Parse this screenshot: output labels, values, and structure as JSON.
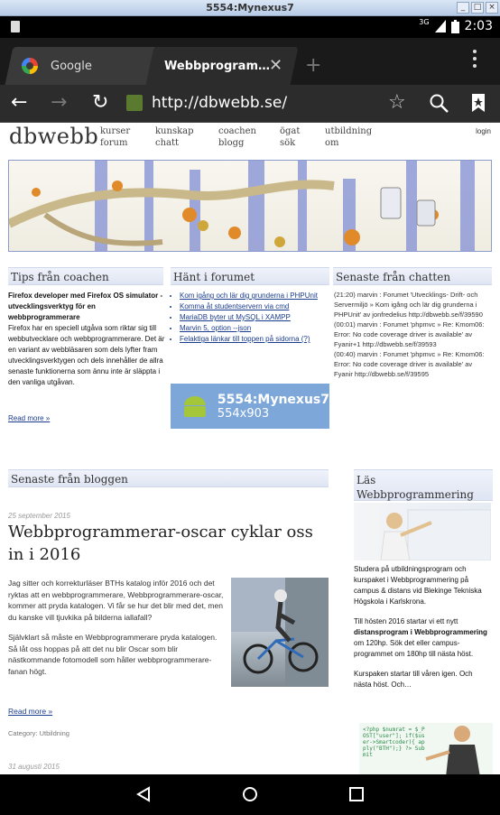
{
  "window": {
    "title": "5554:Mynexus7"
  },
  "status_bar": {
    "signal": "3G",
    "time": "2:03"
  },
  "browser": {
    "tabs": [
      {
        "label": "Google"
      },
      {
        "label": "Webbprogram…"
      }
    ],
    "url": "http://dbwebb.se/"
  },
  "site": {
    "logo": "dbwebb",
    "nav": [
      {
        "top": "kurser",
        "bottom": "forum"
      },
      {
        "top": "kunskap",
        "bottom": "chatt"
      },
      {
        "top": "coachen",
        "bottom": "blogg"
      },
      {
        "top": "ögat",
        "bottom": "sök"
      },
      {
        "top": "utbildning",
        "bottom": "om"
      }
    ],
    "login": "login"
  },
  "coach": {
    "heading": "Tips från coachen",
    "lead": "Firefox developer med Firefox OS simulator - utvecklingsverktyg för en webbprogrammerare",
    "body": "Firefox har en speciell utgåva som riktar sig till webbutvecklare och webbprogrammerare. Det är en variant av webbläsaren som dels lyfter fram utvecklingsverktygen och dels innehåller de allra senaste funktionerna som ännu inte är släppta i den vanliga utgåvan.",
    "read_more": "Read more »"
  },
  "forum": {
    "heading": "Hänt i forumet",
    "items": [
      "Kom igång och lär dig grunderna i PHPUnit",
      "Komma åt studentservern via cmd",
      "MariaDB byter ut MySQL i XAMPP",
      "Marvin 5, option --json",
      "Felaktiga länkar till toppen på sidorna (?)"
    ]
  },
  "emulator_badge": {
    "name": "5554:Mynexus7",
    "size": "554x903"
  },
  "chat": {
    "heading": "Senaste från chatten",
    "lines": [
      "(21:20) marvin : Forumet 'Utvecklings- Drift- och Servermiljö » Kom igång och lär dig grunderna i PHPUnit' av jonfredelius http://dbwebb.se/f/39590",
      "(00:01) marvin : Forumet 'phpmvc » Re: Kmom06: Error: No code coverage driver is available' av Fyanir+1 http://dbwebb.se/f/39593",
      "(00:40) marvin : Forumet 'phpmvc » Re: Kmom06: Error: No code coverage driver is available' av Fyanir http://dbwebb.se/f/39595"
    ]
  },
  "blog": {
    "heading": "Senaste från bloggen",
    "date": "25 september 2015",
    "title": "Webbprogrammerar-oscar cyklar oss in i 2016",
    "p1": "Jag sitter och korrekturläser BTHs katalog inför 2016 och det ryktas att en webbprogrammerare, Webbprogrammerare-oscar, kommer att pryda katalogen. Vi får se hur det blir med det, men du kanske vill tjuvkika på bilderna iallafall?",
    "p2": "Självklart så måste en Webbprogrammerare pryda katalogen. Så låt oss hoppas på att det nu blir Oscar som blir nästkommande fotomodell som håller webbprogrammerare-fanan högt.",
    "read_more": "Read more »",
    "category": "Category: Utbildning",
    "next_date": "31 augusti 2015"
  },
  "sidebar": {
    "heading": "Läs Webbprogrammering vid BTH?",
    "p1": "Studera på utbildningsprogram och kurspaket i Webbprogrammering på campus & distans vid Blekinge Tekniska Högskola i Karlskrona.",
    "p2_a": "Till hösten 2016 startar vi ett nytt",
    "p2_b": "distansprogram i Webbprogrammering",
    "p2_c": "om 120hp. Sök det eller campus-programmet om 180hp till nästa höst.",
    "p3": "Kurspaken startar till våren igen. Och nästa höst. Och…",
    "board_text": "<?php $numrat = $_POST[\"user\"]; if($user->Smartcoder){ apply(\"BTH\");} ?> Submit"
  }
}
